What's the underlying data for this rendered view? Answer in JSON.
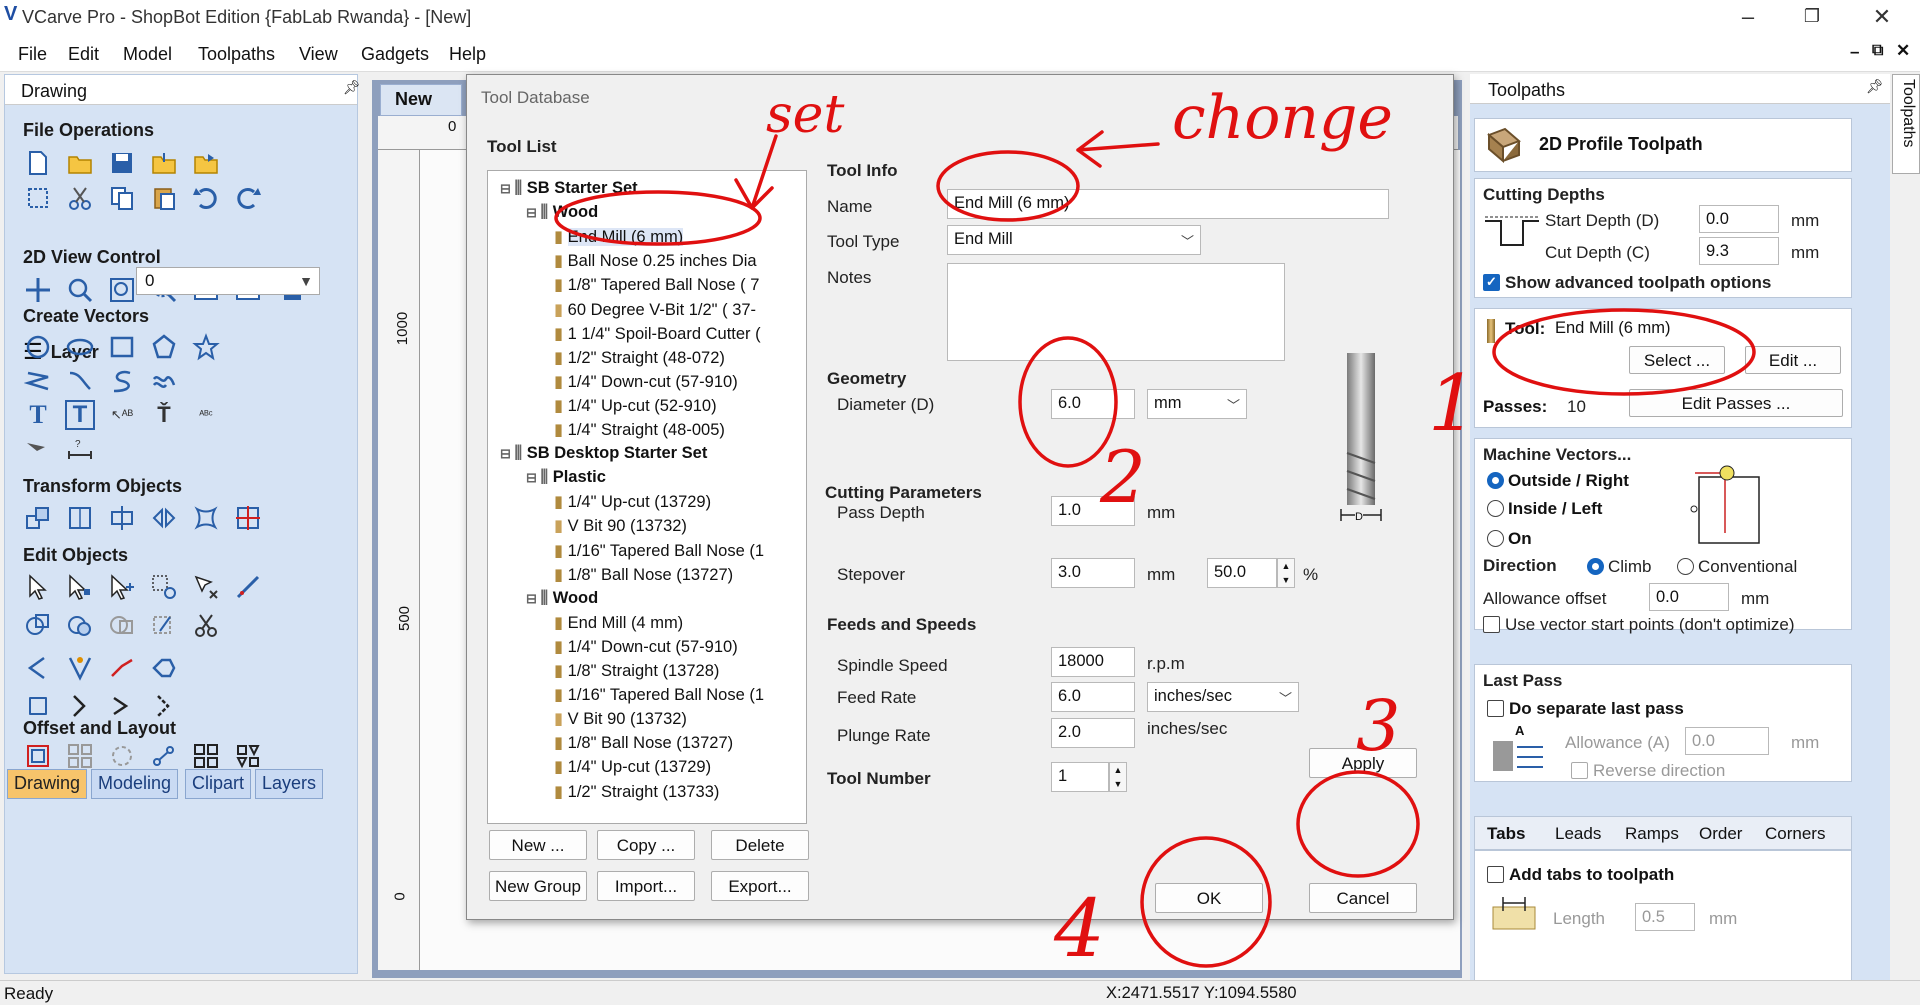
{
  "window": {
    "title": "VCarve Pro - ShopBot Edition {FabLab Rwanda} - [New]"
  },
  "menu": [
    "File",
    "Edit",
    "Model",
    "Toolpaths",
    "View",
    "Gadgets",
    "Help"
  ],
  "left_panel": {
    "header": "Drawing",
    "sections": {
      "file_ops": "File Operations",
      "view_control": "2D View Control",
      "layer_label": "Layer",
      "layer_value": "0",
      "create_vectors": "Create Vectors",
      "transform": "Transform Objects",
      "edit_objects": "Edit Objects",
      "offset_layout": "Offset and Layout"
    },
    "tabs": [
      "Drawing",
      "Modeling",
      "Clipart",
      "Layers"
    ]
  },
  "workspace": {
    "tab": "New",
    "ruler_labels": [
      "1000",
      "500",
      "0"
    ],
    "hruler_label": "0"
  },
  "dialog": {
    "title": "Tool Database",
    "tool_list_label": "Tool List",
    "tree": [
      {
        "text": "SB Starter Set",
        "level": 0,
        "bold": true
      },
      {
        "text": "Wood",
        "level": 1,
        "bold": true
      },
      {
        "text": "End Mill (6 mm)",
        "level": 2,
        "selected": true
      },
      {
        "text": "Ball Nose 0.25 inches Dia",
        "level": 2
      },
      {
        "text": "1/8\" Tapered Ball Nose ( 7",
        "level": 2
      },
      {
        "text": "60 Degree V-Bit 1/2\" ( 37-",
        "level": 2
      },
      {
        "text": "1 1/4\" Spoil-Board Cutter (",
        "level": 2
      },
      {
        "text": "1/2\" Straight  (48-072)",
        "level": 2
      },
      {
        "text": "1/4\"  Down-cut (57-910)",
        "level": 2
      },
      {
        "text": "1/4\" Up-cut (52-910)",
        "level": 2
      },
      {
        "text": "1/4\" Straight  (48-005)",
        "level": 2
      },
      {
        "text": "SB Desktop Starter Set",
        "level": 0,
        "bold": true
      },
      {
        "text": "Plastic",
        "level": 1,
        "bold": true
      },
      {
        "text": "1/4\" Up-cut (13729)",
        "level": 2
      },
      {
        "text": "V Bit 90 (13732)",
        "level": 2
      },
      {
        "text": "1/16\" Tapered Ball Nose (1",
        "level": 2
      },
      {
        "text": "1/8\" Ball Nose (13727)",
        "level": 2
      },
      {
        "text": "Wood",
        "level": 1,
        "bold": true
      },
      {
        "text": "End Mill (4 mm)",
        "level": 2
      },
      {
        "text": "1/4\"  Down-cut (57-910)",
        "level": 2
      },
      {
        "text": "1/8\" Straight (13728)",
        "level": 2
      },
      {
        "text": "1/16\" Tapered Ball Nose (1",
        "level": 2
      },
      {
        "text": "V Bit 90 (13732)",
        "level": 2
      },
      {
        "text": "1/8\" Ball Nose (13727)",
        "level": 2
      },
      {
        "text": "1/4\" Up-cut (13729)",
        "level": 2
      },
      {
        "text": "1/2\" Straight (13733)",
        "level": 2
      }
    ],
    "buttons": {
      "new": "New ...",
      "copy": "Copy ...",
      "delete": "Delete",
      "new_group": "New Group",
      "import": "Import...",
      "export": "Export...",
      "apply": "Apply",
      "ok": "OK",
      "cancel": "Cancel"
    },
    "tool_info": {
      "header": "Tool Info",
      "name_label": "Name",
      "name_value": "End Mill (6 mm)",
      "type_label": "Tool Type",
      "type_value": "End Mill",
      "notes_label": "Notes"
    },
    "geometry": {
      "header": "Geometry",
      "diameter_label": "Diameter (D)",
      "diameter_value": "6.0",
      "unit": "mm"
    },
    "cutting": {
      "header": "Cutting Parameters",
      "pass_depth_label": "Pass Depth",
      "pass_depth_value": "1.0",
      "pass_unit": "mm",
      "stepover_label": "Stepover",
      "stepover_value": "3.0",
      "stepover_unit": "mm",
      "stepover_pct": "50.0",
      "pct": "%"
    },
    "feeds": {
      "header": "Feeds and Speeds",
      "spindle_label": "Spindle Speed",
      "spindle_value": "18000",
      "spindle_unit": "r.p.m",
      "feed_label": "Feed Rate",
      "feed_value": "6.0",
      "feed_unit": "inches/sec",
      "plunge_label": "Plunge Rate",
      "plunge_value": "2.0",
      "plunge_unit": "inches/sec"
    },
    "tool_number": {
      "label": "Tool Number",
      "value": "1"
    },
    "diagram_label": "D"
  },
  "right_panel": {
    "header": "Toolpaths",
    "vertical_tab": "Toolpaths",
    "title": "2D Profile Toolpath",
    "cutting_depths": {
      "header": "Cutting Depths",
      "start_label": "Start Depth (D)",
      "start_value": "0.0",
      "cut_label": "Cut Depth (C)",
      "cut_value": "9.3",
      "unit": "mm"
    },
    "advanced_label": "Show advanced toolpath options",
    "tool": {
      "label": "Tool:",
      "value": "End Mill (6 mm)",
      "select": "Select ...",
      "edit": "Edit ..."
    },
    "passes": {
      "label": "Passes:",
      "value": "10",
      "button": "Edit Passes ..."
    },
    "machine": {
      "header": "Machine Vectors...",
      "outside": "Outside / Right",
      "inside": "Inside / Left",
      "on": "On",
      "direction": "Direction",
      "climb": "Climb",
      "conventional": "Conventional",
      "allowance_label": "Allowance offset",
      "allowance_value": "0.0",
      "unit": "mm",
      "start_points": "Use vector start points (don't optimize)"
    },
    "last_pass": {
      "header": "Last Pass",
      "separate": "Do separate last pass",
      "allowance_label": "Allowance (A)",
      "allowance_value": "0.0",
      "unit": "mm",
      "reverse": "Reverse direction",
      "a_label": "A"
    },
    "tabs": [
      "Tabs",
      "Leads",
      "Ramps",
      "Order",
      "Corners"
    ],
    "tabs_content": {
      "add": "Add tabs to toolpath",
      "length_label": "Length",
      "length_value": "0.5",
      "unit": "mm"
    }
  },
  "status": {
    "ready": "Ready",
    "coords": "X:2471.5517 Y:1094.5580"
  },
  "annotations": {
    "set": "set",
    "change": "chonge",
    "n1": "1",
    "n2": "2",
    "n3": "3",
    "n4": "4"
  }
}
